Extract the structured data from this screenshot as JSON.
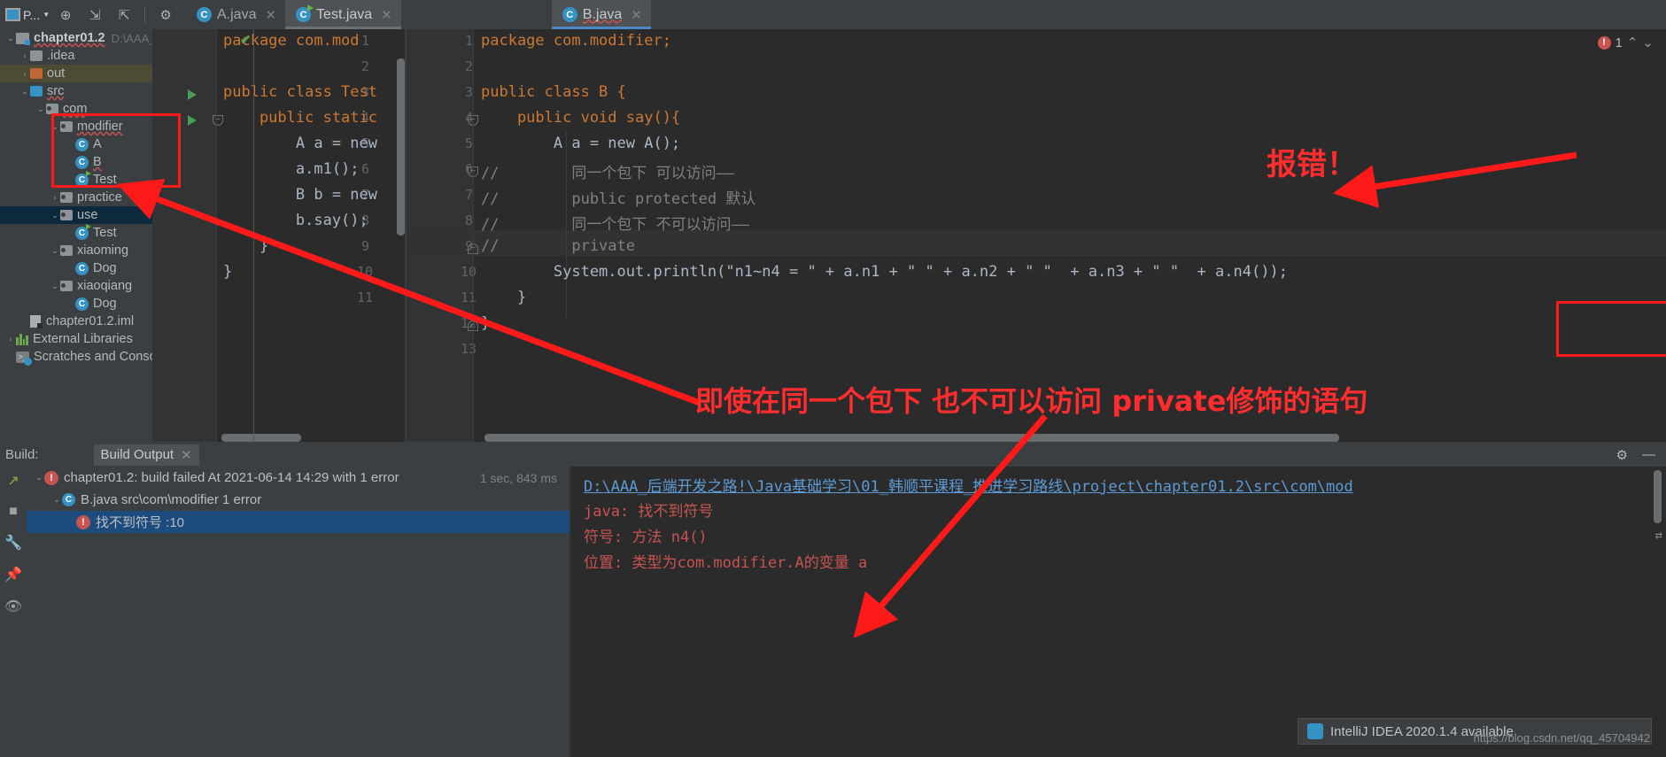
{
  "toolbar": {
    "project_label": "P...",
    "icons": [
      "project-selector-icon",
      "locate-icon",
      "expand-all-icon",
      "collapse-all-icon",
      "settings-gear-icon"
    ]
  },
  "tabs": [
    {
      "label": "A.java",
      "icon": "java-class-icon",
      "state": "inactive",
      "runnable": false
    },
    {
      "label": "Test.java",
      "icon": "java-runnable-class-icon",
      "state": "active-left",
      "runnable": true
    },
    {
      "label": "B.java",
      "icon": "java-class-icon",
      "state": "active-right",
      "runnable": false
    }
  ],
  "tree": {
    "items": [
      {
        "label": "chapter01.2",
        "path": "D:\\AAA_",
        "icon": "module-icon",
        "arrow": "expanded",
        "indent": 0,
        "bold": true
      },
      {
        "label": ".idea",
        "icon": "folder-icon",
        "arrow": "collapsed",
        "indent": 1
      },
      {
        "label": "out",
        "icon": "folder-out-icon",
        "arrow": "collapsed",
        "indent": 1,
        "selected": "out"
      },
      {
        "label": "src",
        "icon": "folder-source-icon",
        "arrow": "expanded",
        "indent": 1
      },
      {
        "label": "com",
        "icon": "package-icon",
        "arrow": "expanded",
        "indent": 2
      },
      {
        "label": "modifier",
        "icon": "package-icon",
        "arrow": "expanded",
        "indent": 3
      },
      {
        "label": "A",
        "icon": "java-class-icon",
        "arrow": "none",
        "indent": 4
      },
      {
        "label": "B",
        "icon": "java-class-icon",
        "arrow": "none",
        "indent": 4
      },
      {
        "label": "Test",
        "icon": "java-runnable-class-icon",
        "arrow": "none",
        "indent": 4
      },
      {
        "label": "practice",
        "icon": "package-icon",
        "arrow": "collapsed",
        "indent": 3
      },
      {
        "label": "use",
        "icon": "package-icon",
        "arrow": "expanded",
        "indent": 3,
        "selected": "use"
      },
      {
        "label": "Test",
        "icon": "java-runnable-class-icon",
        "arrow": "none",
        "indent": 4
      },
      {
        "label": "xiaoming",
        "icon": "package-icon",
        "arrow": "expanded",
        "indent": 3
      },
      {
        "label": "Dog",
        "icon": "java-class-icon",
        "arrow": "none",
        "indent": 4
      },
      {
        "label": "xiaoqiang",
        "icon": "package-icon",
        "arrow": "expanded",
        "indent": 3
      },
      {
        "label": "Dog",
        "icon": "java-class-icon",
        "arrow": "none",
        "indent": 4
      },
      {
        "label": "chapter01.2.iml",
        "icon": "iml-file-icon",
        "arrow": "none",
        "indent": 2
      },
      {
        "label": "External Libraries",
        "icon": "libraries-icon",
        "arrow": "collapsed",
        "indent": 0
      },
      {
        "label": "Scratches and Console",
        "icon": "scratches-icon",
        "arrow": "none",
        "indent": 0
      }
    ]
  },
  "editor_left": {
    "file": "Test.java",
    "lines": [
      {
        "n": 1,
        "text": "package com.mod",
        "runnable": false
      },
      {
        "n": 2,
        "text": "",
        "runnable": false
      },
      {
        "n": 3,
        "text": "public class Test",
        "runnable": true
      },
      {
        "n": 4,
        "text": "    public static",
        "runnable": true,
        "fold": true
      },
      {
        "n": 5,
        "text": "        A a = new"
      },
      {
        "n": 6,
        "text": "        a.m1();"
      },
      {
        "n": 7,
        "text": "        B b = new"
      },
      {
        "n": 8,
        "text": "        b.say();"
      },
      {
        "n": 9,
        "text": "    }"
      },
      {
        "n": 10,
        "text": "}"
      },
      {
        "n": 11,
        "text": ""
      }
    ],
    "inspection_status": "ok-check"
  },
  "editor_right": {
    "file": "B.java",
    "error_count": "1",
    "lines": [
      {
        "n": 1,
        "text": "package com.modifier;"
      },
      {
        "n": 2,
        "text": ""
      },
      {
        "n": 3,
        "text": "public class B {"
      },
      {
        "n": 4,
        "text": "    public void say(){",
        "fold": true
      },
      {
        "n": 5,
        "text": "        A a = new A();"
      },
      {
        "n": 6,
        "text": "//        同一个包下 可以访问——",
        "comment": true,
        "fold": true
      },
      {
        "n": 7,
        "text": "//        public protected 默认",
        "comment": true
      },
      {
        "n": 8,
        "text": "//        同一个包下 不可以访问——",
        "comment": true,
        "highlight": true
      },
      {
        "n": 9,
        "text": "//        private",
        "comment": true,
        "fold": true
      },
      {
        "n": 10,
        "text": "        System.out.println(\"n1~n4 = \" + a.n1 + \" \" + a.n2 + \" \"  + a.n3 + \" \"  + a.n4());"
      },
      {
        "n": 11,
        "text": "    }"
      },
      {
        "n": 12,
        "text": "}"
      },
      {
        "n": 13,
        "text": ""
      }
    ]
  },
  "build": {
    "label": "Build:",
    "tab_label": "Build Output",
    "rows": [
      {
        "label": "chapter01.2: build failed At 2021-06-14 14:29 with 1 error",
        "icon": "error-icon",
        "arrow": "expanded",
        "indent": 0,
        "time": "1 sec, 843 ms"
      },
      {
        "label": "B.java src\\com\\modifier 1 error",
        "icon": "error-icon",
        "arrow": "expanded",
        "indent": 1
      },
      {
        "label": "找不到符号 :10",
        "icon": "error-icon",
        "arrow": "none",
        "indent": 2,
        "selected": true
      }
    ],
    "console": {
      "path_link": "D:\\AAA_后端开发之路!\\Java基础学习\\01_韩顺平课程_推进学习路线\\project\\chapter01.2\\src\\com\\mod",
      "lines": [
        "java: 找不到符号",
        "  符号:   方法 n4()",
        "  位置: 类型为com.modifier.A的变量 a"
      ]
    }
  },
  "notification": {
    "text": "IntelliJ IDEA 2020.1.4 available"
  },
  "watermark": "https://blog.csdn.net/qq_45704942",
  "annotations": {
    "error_cn": "报错！",
    "explain_cn": "即使在同一个包下 也不可以访问 private修饰的语句"
  },
  "colors": {
    "accent_blue": "#3592c4",
    "error_red": "#c75450",
    "annotation_red": "#ff1a1a",
    "keyword_orange": "#cc7832",
    "string_green": "#6a8759",
    "selection_blue": "#0d293e"
  }
}
